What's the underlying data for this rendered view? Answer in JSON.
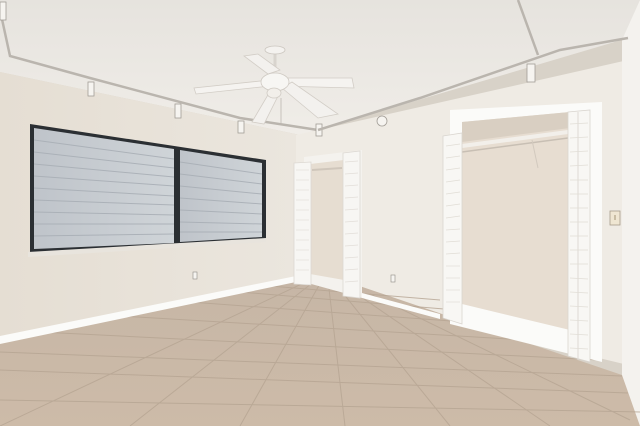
{
  "scene": {
    "description_hidden": "",
    "colors": {
      "ceiling": "#ebe8e3",
      "wall_left": "#e9e3da",
      "wall_back": "#efebe5",
      "wall_right": "#f3f1ee",
      "floor": "#c9b8a6",
      "floor_grout": "#b4a391",
      "baseboard": "#fbfbf9",
      "window_blind": "#c8cdd2",
      "window_frame": "#2b2f33",
      "door": "#f7f6f3",
      "closet_interior": "#e7ddd1",
      "track": "#b9b5ae",
      "fan": "#f4f2ef"
    },
    "objects": [
      "ceiling-fan",
      "track-lighting-left",
      "track-lighting-right",
      "window-with-blinds",
      "left-closet",
      "right-closet",
      "bifold-door",
      "electrical-outlet",
      "light-switch",
      "tile-floor"
    ]
  }
}
